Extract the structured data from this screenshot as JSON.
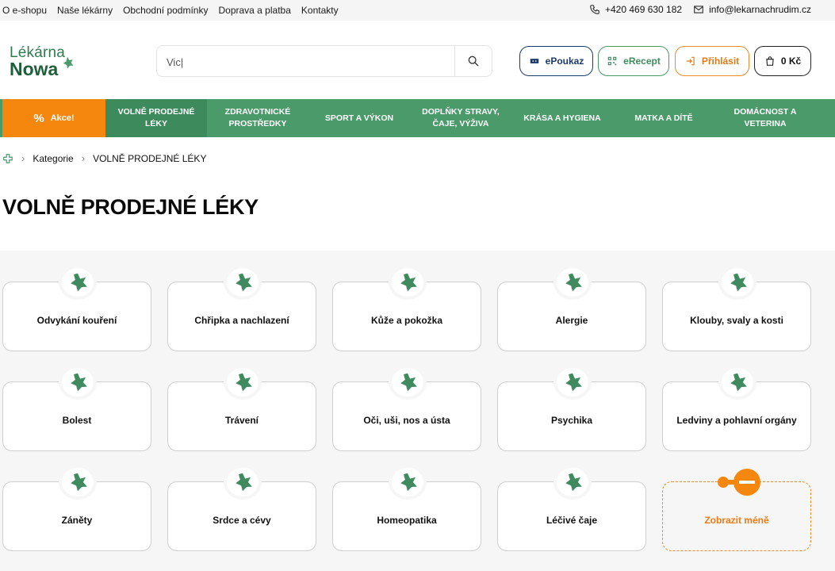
{
  "topbar": {
    "links": [
      "O e-shopu",
      "Naše lékárny",
      "Obchodní podmínky",
      "Doprava a platba",
      "Kontakty"
    ],
    "phone": "+420 469 630 182",
    "email": "info@lekarnachrudim.cz"
  },
  "logo": {
    "line1": "Lékárna",
    "line2": "Nowa"
  },
  "search": {
    "value": "Vic|"
  },
  "header_buttons": {
    "epoukaz": "ePoukaz",
    "erecept": "eRecept",
    "login": "Přihlásit",
    "cart": "0 Kč"
  },
  "nav": {
    "akce": "Akce!",
    "items": [
      "VOLNĚ PRODEJNÉ LÉKY",
      "ZDRAVOTNICKÉ PROSTŘEDKY",
      "SPORT A VÝKON",
      "DOPLŇKY STRAVY, ČAJE, VÝŽIVA",
      "KRÁSA A HYGIENA",
      "MATKA A DÍTĚ",
      "DOMÁCNOST A VETERINA"
    ]
  },
  "breadcrumb": {
    "items": [
      "Kategorie",
      "VOLNĚ PRODEJNÉ LÉKY"
    ]
  },
  "page_title": "VOLNĚ PRODEJNÉ LÉKY",
  "categories": [
    "Odvykání kouření",
    "Chřipka a nachlazení",
    "Kůže a pokožka",
    "Alergie",
    "Klouby, svaly a kosti",
    "Bolest",
    "Trávení",
    "Oči, uši, nos a ústa",
    "Psychika",
    "Ledviny a pohlavní orgány",
    "Záněty",
    "Srdce a cévy",
    "Homeopatika",
    "Léčivé čaje"
  ],
  "show_less": "Zobrazit méně",
  "colors": {
    "green": "#4a9a6a",
    "orange": "#f5870f",
    "navy": "#1b3a6b"
  }
}
